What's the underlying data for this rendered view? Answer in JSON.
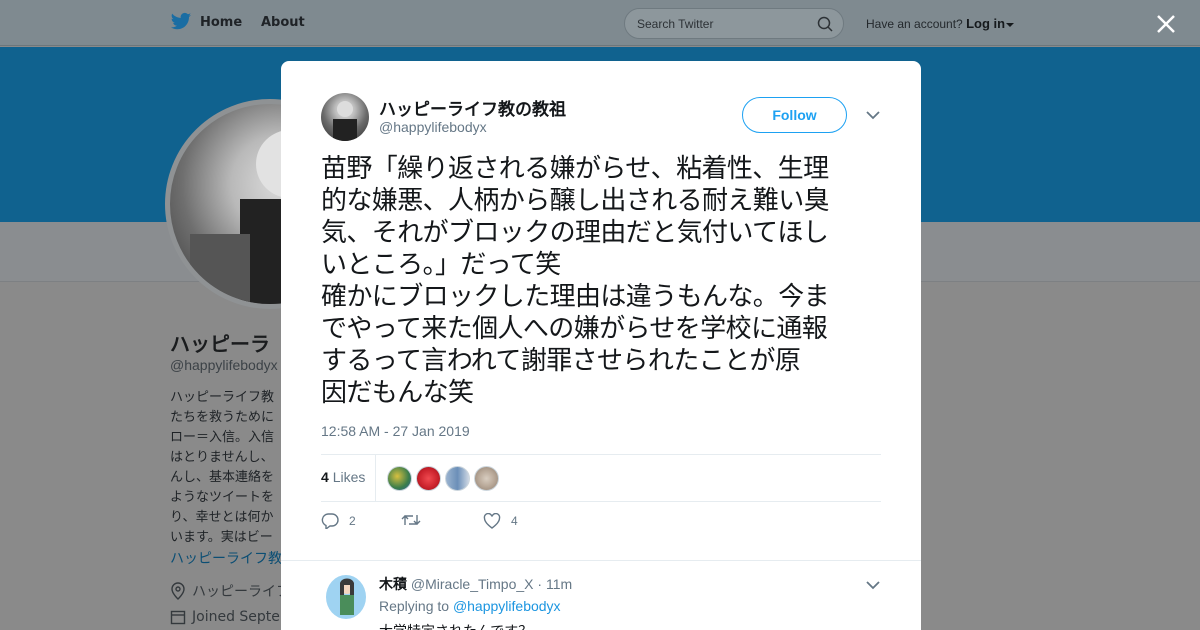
{
  "nav": {
    "home_label": "Home",
    "about_label": "About",
    "search_placeholder": "Search Twitter",
    "account_prompt": "Have an account?",
    "login_label": "Log in"
  },
  "background_profile": {
    "name": "ハッピーライフ教の教祖",
    "name_visible": "ハッピーラ",
    "handle": "@happylifebodyx",
    "bio": "ハッピーライフ教\nたちを救うために\nロー＝入信。入信\nはとりませんし、\nんし、基本連絡を\nようなツイートを\nり、幸せとは何か\nいます。実はビー",
    "link": "ハッピーライフ教",
    "location": "ハッピーライフ",
    "joined": "Joined Septen"
  },
  "tweet": {
    "author_name": "ハッピーライフ教の教祖",
    "author_handle": "@happylifebodyx",
    "follow_label": "Follow",
    "text": "苗野「繰り返される嫌がらせ、粘着性、生理\n的な嫌悪、人柄から醸し出される耐え難い臭\n気、それがブロックの理由だと気付いてほし\nいところ。」だって笑\n確かにブロックした理由は違うもんな。今ま\nでやって来た個人への嫌がらせを学校に通報\nするって言われて謝罪させられたことが原\n因だもんな笑",
    "timestamp": "12:58 AM - 27 Jan 2019",
    "likes_count": "4",
    "likes_label": "Likes",
    "reply_count": "2",
    "retweet_count": "",
    "like_action_count": "4",
    "liker_colors": [
      "#3a7d4a",
      "#c8202a",
      "#6b8fb8",
      "#b8a898"
    ]
  },
  "reply": {
    "author_name": "木積",
    "author_handle": "@Miracle_Timpo_X",
    "time": "11m",
    "replying_prefix": "Replying to",
    "replying_to": "@happylifebodyx",
    "text": "大学特定されたんです？"
  },
  "colors": {
    "accent": "#1da1f2",
    "banner": "#10628f"
  }
}
